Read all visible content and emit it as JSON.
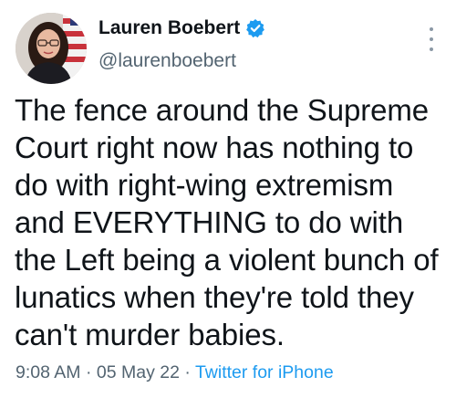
{
  "author": {
    "display_name": "Lauren Boebert",
    "handle": "@laurenboebert",
    "verified": true,
    "avatar_icon": "profile-photo"
  },
  "tweet": {
    "text": "The fence around the Supreme Court right now has nothing to do with right-wing extremism and EVERYTHING to do with the Left being a violent bunch of lunatics when they're told they can't murder babies."
  },
  "meta": {
    "time": "9:08 AM",
    "separator_1": " · ",
    "date": "05 May 22",
    "separator_2": " · ",
    "source": "Twitter for iPhone"
  },
  "colors": {
    "verified_blue": "#1d9bf0",
    "link_blue": "#1d9bf0",
    "secondary_text": "#536471",
    "primary_text": "#0f1419"
  },
  "icons": {
    "more": "more-vertical-icon",
    "verified": "verified-badge-icon"
  }
}
